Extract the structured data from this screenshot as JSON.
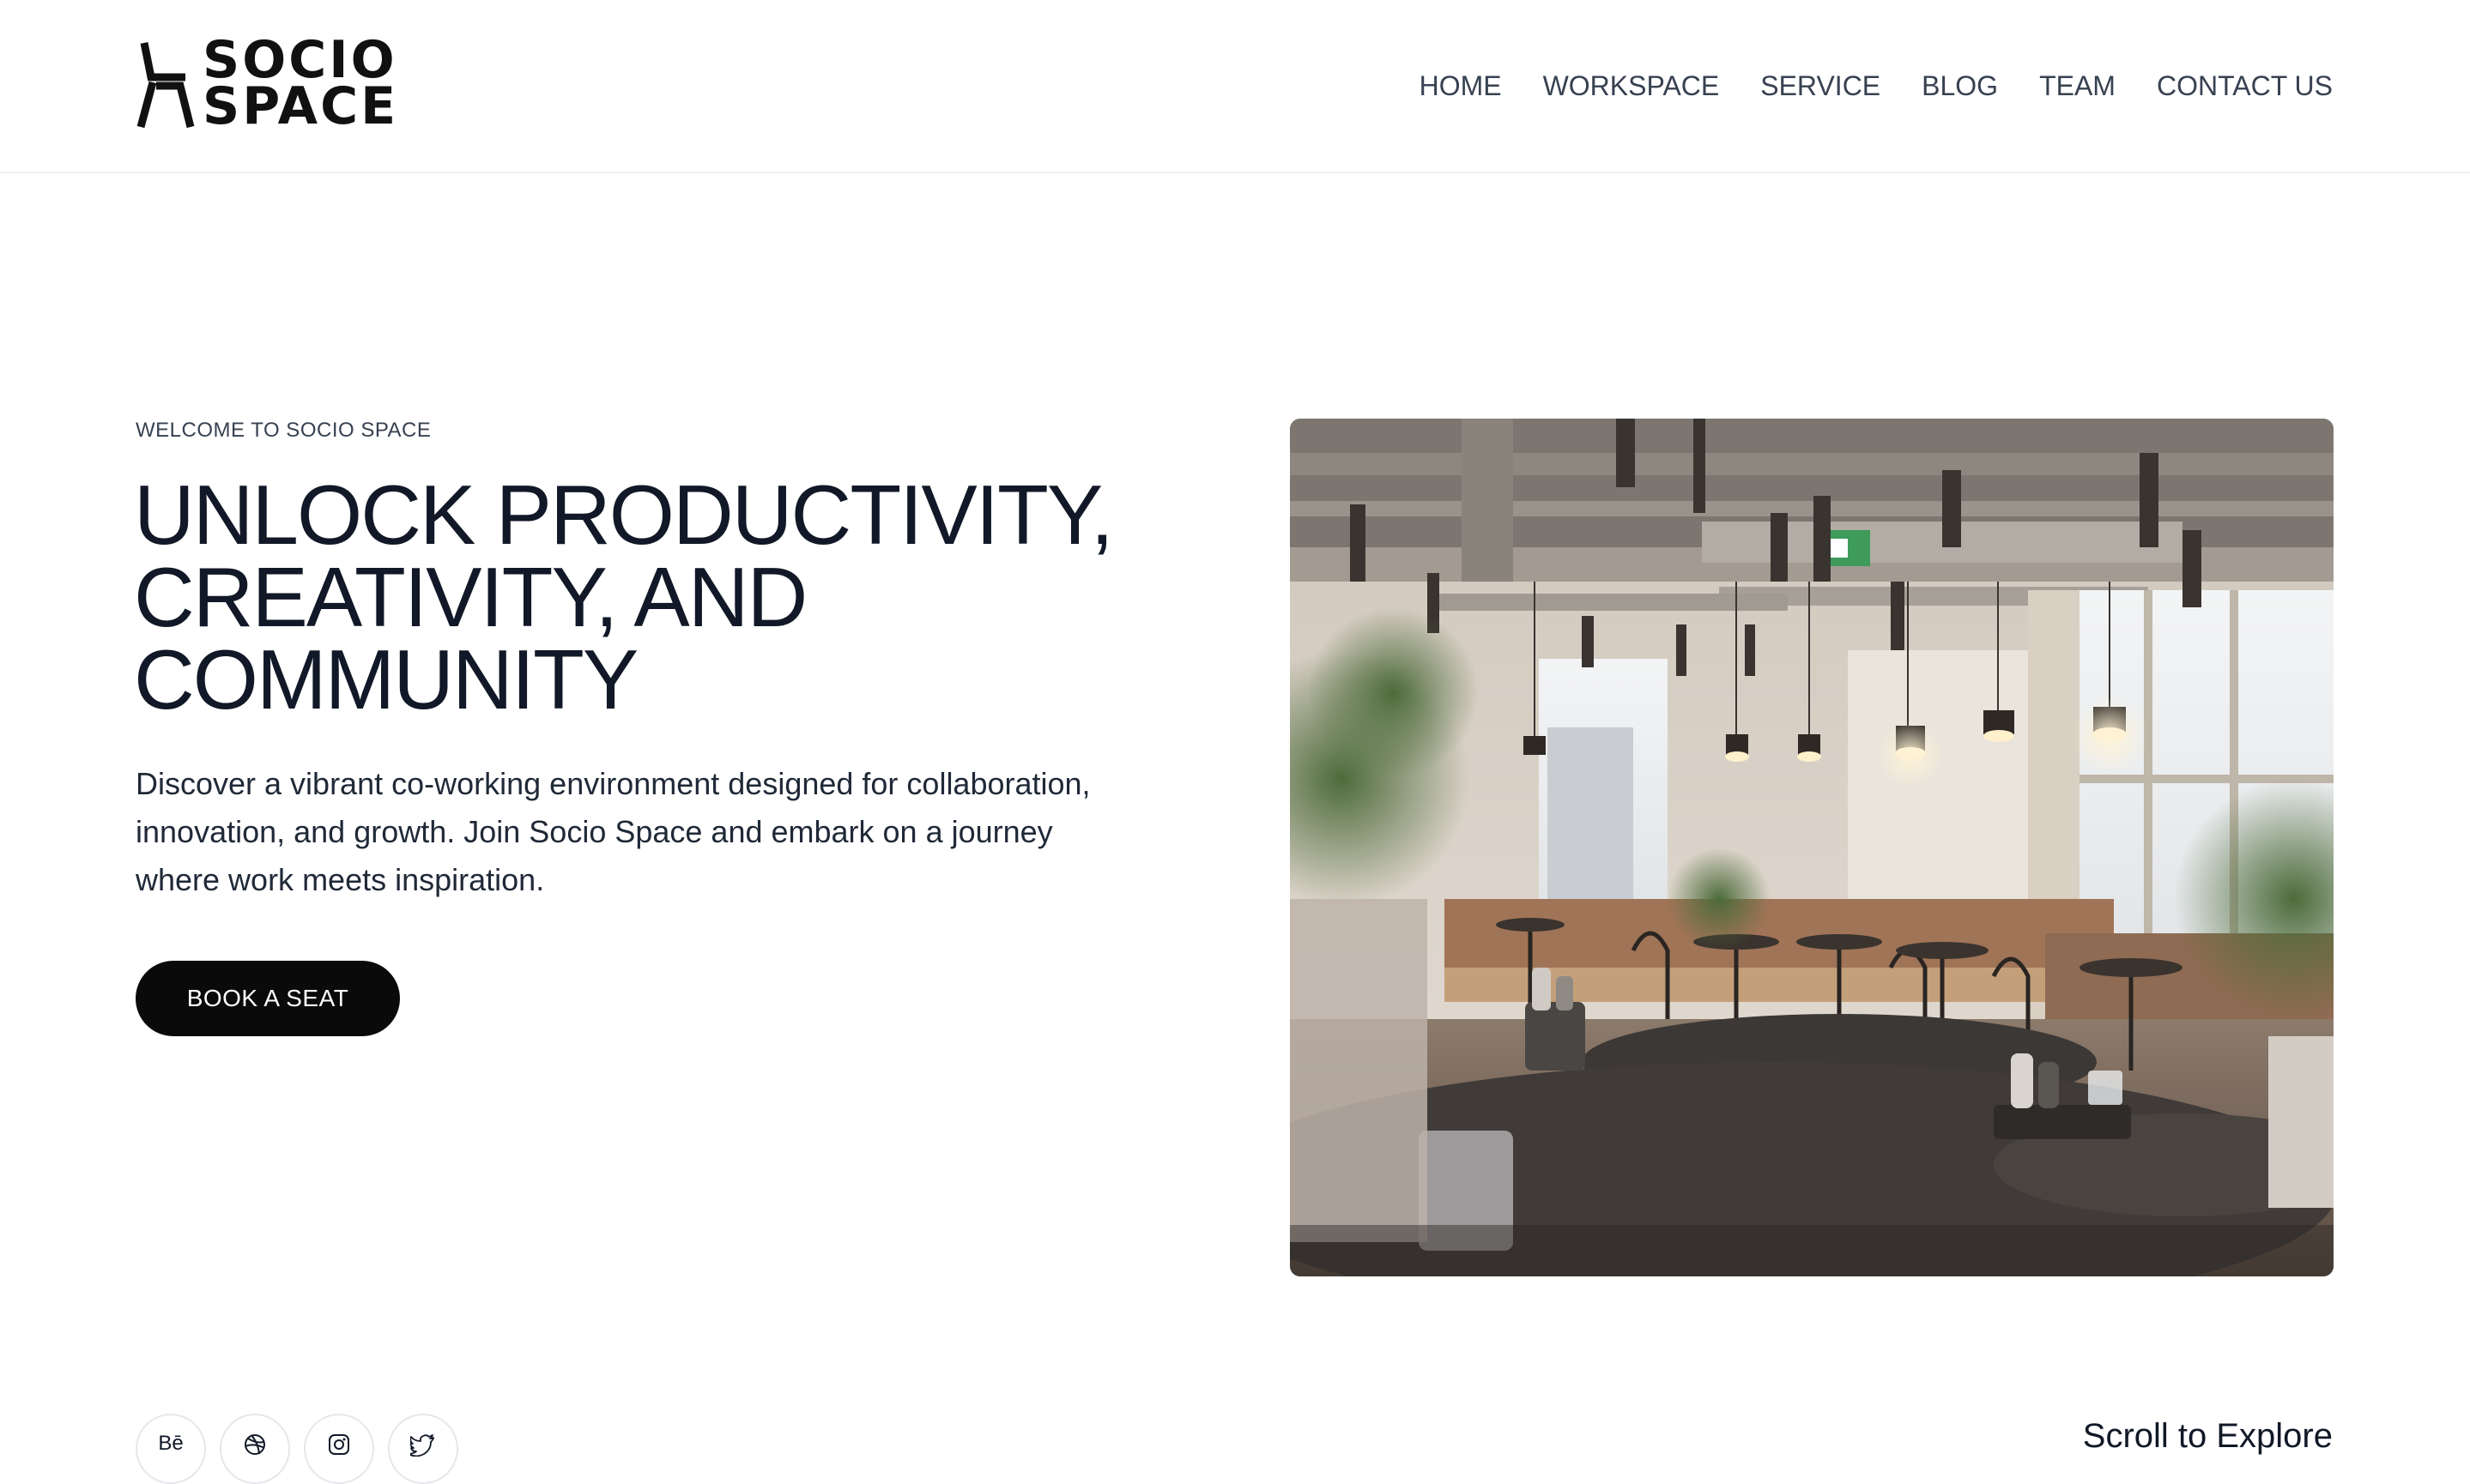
{
  "brand": {
    "line1": "SOCIO",
    "line2": "SPACE"
  },
  "nav": {
    "items": [
      {
        "label": "HOME"
      },
      {
        "label": "WORKSPACE"
      },
      {
        "label": "SERVICE"
      },
      {
        "label": "BLOG"
      },
      {
        "label": "TEAM"
      },
      {
        "label": "CONTACT US"
      }
    ]
  },
  "hero": {
    "eyebrow": "WELCOME TO SOCIO SPACE",
    "title": "UNLOCK PRODUCTIVITY, CREATIVITY, AND COMMUNITY",
    "description": "Discover a vibrant co-working environment designed for collaboration, innovation, and growth. Join Socio Space and embark on a journey where work meets inspiration.",
    "cta_label": "BOOK A SEAT"
  },
  "socials": [
    {
      "icon": "behance-icon",
      "glyph": "Bē"
    },
    {
      "icon": "dribbble-icon"
    },
    {
      "icon": "instagram-icon"
    },
    {
      "icon": "twitter-icon"
    }
  ],
  "scroll_hint": "Scroll to Explore",
  "colors": {
    "text": "#111827",
    "muted": "#374151",
    "cta_bg": "#0a0a0a",
    "cta_text": "#ffffff"
  }
}
